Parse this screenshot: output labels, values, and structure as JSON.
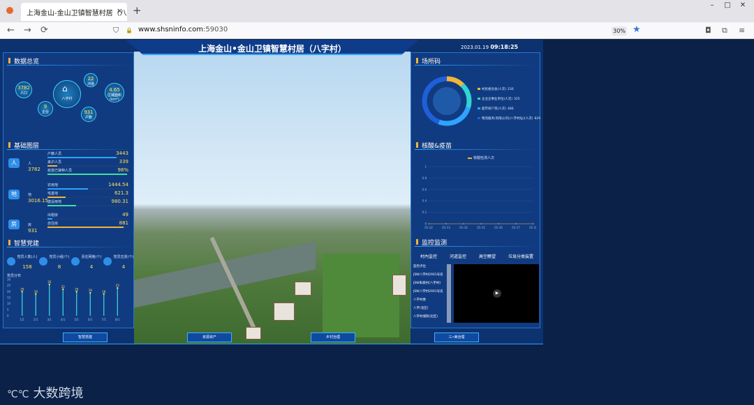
{
  "browser": {
    "tab_title": "上海金山-金山卫镇智慧村居（八字村",
    "close": "×",
    "new_tab": "+",
    "back": "←",
    "forward": "→",
    "reload": "⟳",
    "shield": "⛉",
    "lock": "🔒",
    "url_host": "www.shsninfo.com",
    "url_port": ":59030",
    "zoom": "30%",
    "star": "★",
    "minimize": "–",
    "maximize": "□",
    "close_window": "✕"
  },
  "dashboard": {
    "title": "上海金山•金山卫镇智慧村居（八字村）",
    "date": "2023.01.19",
    "time": "09:18:25",
    "overview": {
      "title": "数据总览",
      "center": "八字村",
      "stats": [
        {
          "value": "3782",
          "label": "人口"
        },
        {
          "value": "22",
          "label": "河道"
        },
        {
          "value": "4.65",
          "label": "区域面积(km²)"
        },
        {
          "value": "9",
          "label": "企业"
        },
        {
          "value": "931",
          "label": "户数"
        }
      ]
    },
    "base": {
      "title": "基础图层",
      "groups": [
        {
          "icon": "人",
          "name": "人",
          "total": "3782",
          "rows": [
            {
              "label": "户籍人员",
              "value": "3443",
              "pct": 0.85
            },
            {
              "label": "来沪人员",
              "value": "339",
              "pct": 0.12
            },
            {
              "label": "疫苗已接种人员",
              "value": "98%",
              "pct": 0.98
            }
          ]
        },
        {
          "icon": "地",
          "name": "地",
          "total": "3016.15",
          "rows": [
            {
              "label": "农用地",
              "value": "1444.54",
              "pct": 0.5
            },
            {
              "label": "宅基地",
              "value": "621.3",
              "pct": 0.22
            },
            {
              "label": "建设用地",
              "value": "980.31",
              "pct": 0.35
            }
          ]
        },
        {
          "icon": "房",
          "name": "房",
          "total": "931",
          "rows": [
            {
              "label": "出租房",
              "value": "49",
              "pct": 0.06
            },
            {
              "label": "自住房",
              "value": "881",
              "pct": 0.94
            }
          ]
        }
      ]
    },
    "party": {
      "title": "智慧党建",
      "stats": [
        {
          "label": "党员人数(人)",
          "value": "158"
        },
        {
          "label": "党员小组(个)",
          "value": "8"
        },
        {
          "label": "责任网格(个)",
          "value": "4"
        },
        {
          "label": "党员志愿(个)",
          "value": "4"
        }
      ],
      "axis_label": "党员分布"
    },
    "venue": {
      "title": "场所码",
      "items": [
        {
          "label": "村民委员会(人次)",
          "value": "230",
          "color": "#f0b53a"
        },
        {
          "label": "企业企事业单位(人次)",
          "value": "325",
          "color": "#2fd4d4"
        },
        {
          "label": "超市商户等(人次)",
          "value": "486",
          "color": "#2ea3ff"
        },
        {
          "label": "物流服务(有限公司)(八字村址)(人次)",
          "value": "829",
          "color": "#1f5fd9"
        }
      ]
    },
    "nucleic": {
      "title": "核酸&疫苗",
      "legend": "核酸检测人次"
    },
    "monitor": {
      "title": "监控监测",
      "tabs": [
        "村內监控",
        "河道监控",
        "高空瞭望",
        "垃圾分类装置"
      ],
      "list": [
        "监控点位",
        "JSW八字村2001号农",
        "JSW朱家村(八字村)",
        "JSW八字村2001号农",
        "八字村委",
        "八字(北区)",
        "八字村城际(北区)"
      ]
    },
    "buttons": [
      "智慧党建",
      "资源资产",
      "乡村治理",
      "三•美治理"
    ]
  },
  "chart_data": [
    {
      "type": "bar",
      "title": "",
      "categories": [
        "1/1",
        "2/1",
        "3/1",
        "4/1",
        "5/1",
        "6/1",
        "7/1",
        "8/1"
      ],
      "values": [
        20,
        18,
        26,
        22,
        20,
        19,
        18,
        23
      ],
      "ylim": [
        0,
        30
      ],
      "yticks": [
        "0",
        "5",
        "10",
        "15",
        "20",
        "25",
        "30"
      ]
    },
    {
      "type": "line",
      "title": "",
      "categories": [
        "01-12",
        "01-13",
        "01-14",
        "01-15",
        "01-16",
        "01-17",
        "01-18"
      ],
      "series": [
        {
          "name": "核酸检测人次",
          "values": [
            0,
            0,
            0,
            0,
            0,
            0,
            0
          ]
        }
      ],
      "ylim": [
        0,
        1
      ],
      "yticks": [
        "0",
        "0.2",
        "0.4",
        "0.6",
        "0.8",
        "1"
      ]
    }
  ]
}
